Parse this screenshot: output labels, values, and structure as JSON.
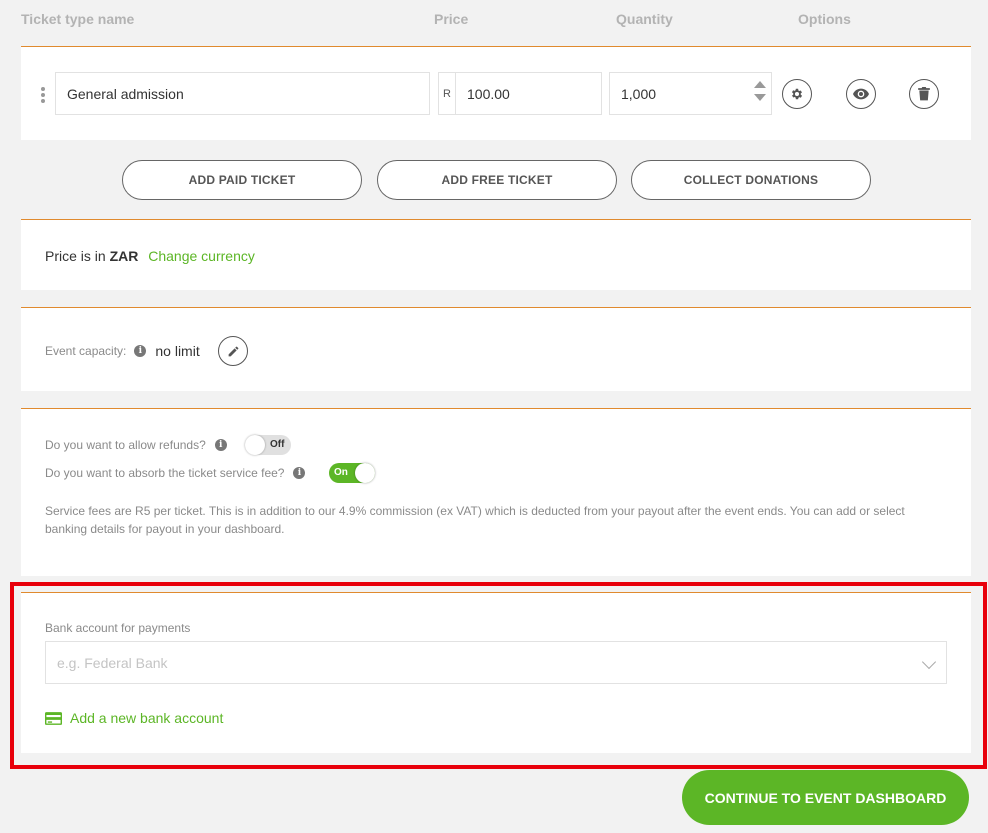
{
  "columns": {
    "name": "Ticket type name",
    "price": "Price",
    "quantity": "Quantity",
    "options": "Options"
  },
  "ticket": {
    "name_value": "General admission",
    "currency_symbol": "R",
    "price_value": "100.00",
    "quantity_value": "1,000"
  },
  "buttons": {
    "add_paid": "ADD PAID TICKET",
    "add_free": "ADD FREE TICKET",
    "collect_donations": "COLLECT DONATIONS",
    "continue": "CONTINUE TO EVENT DASHBOARD"
  },
  "currency": {
    "prefix": "Price is in",
    "code": "ZAR",
    "change_link": "Change currency"
  },
  "capacity": {
    "label": "Event capacity:",
    "value": "no limit"
  },
  "refunds": {
    "question": "Do you want to allow refunds?",
    "toggle_label": "Off"
  },
  "service_fee": {
    "question": "Do you want to absorb the ticket service fee?",
    "toggle_label": "On",
    "note": "Service fees are R5 per ticket. This is in addition to our 4.9% commission (ex VAT) which is deducted from your payout after the event ends. You can add or select banking details for payout in your dashboard."
  },
  "bank": {
    "label": "Bank account for payments",
    "placeholder": "e.g. Federal Bank",
    "add_link": "Add a new bank account"
  },
  "colors": {
    "accent": "#e08a2e",
    "green": "#5cb626",
    "highlight": "#e8000b"
  }
}
